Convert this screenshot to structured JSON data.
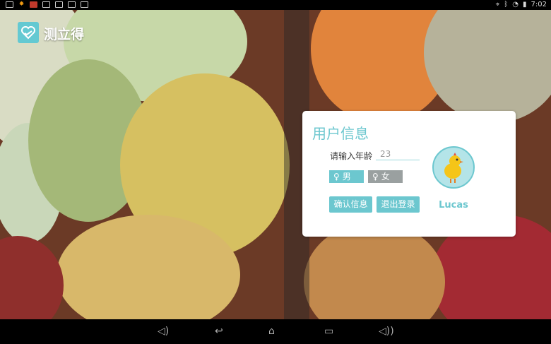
{
  "status_bar": {
    "left_icons": [
      "app-icon",
      "brightness-icon",
      "gallery-icon",
      "monitor-icon",
      "notification-icon",
      "usb-icon",
      "keyboard-icon"
    ],
    "right_icons": [
      "location-icon",
      "bluetooth-icon",
      "wifi-icon",
      "battery-icon"
    ],
    "time": "7:02"
  },
  "app": {
    "title": "测立得",
    "logo_icon": "heart-hands-icon",
    "accent_color": "#6cc7cf"
  },
  "card": {
    "title": "用户信息",
    "age_label": "请输入年龄",
    "age_value": "23",
    "gender_male": "男",
    "gender_female": "女",
    "confirm_button": "确认信息",
    "logout_button": "退出登录",
    "username": "Lucas",
    "avatar_icon": "chick-icon"
  },
  "nav_bar": {
    "icons": [
      "volume-down-icon",
      "back-icon",
      "home-icon",
      "recents-icon",
      "volume-up-icon"
    ]
  }
}
